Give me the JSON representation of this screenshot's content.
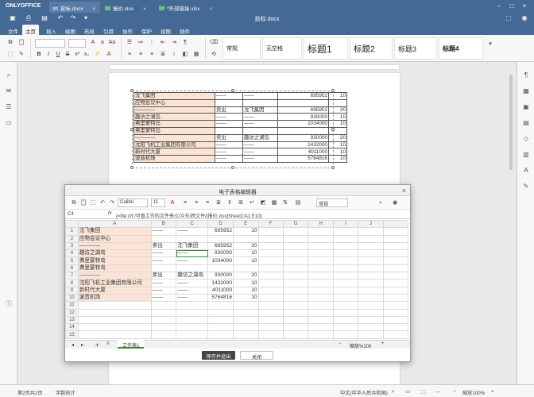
{
  "app": {
    "brand": "ONLYOFFICE",
    "doc_title": "投标.docx"
  },
  "window_tabs": [
    {
      "label": "投标.docx",
      "color": "#446995",
      "active": true
    },
    {
      "label": "报价.xlsx",
      "color": "#40865c",
      "active": false
    },
    {
      "label": "*外部链接.xlsx",
      "color": "#40865c",
      "active": false
    }
  ],
  "menu_tabs": [
    "文件",
    "主页",
    "插入",
    "绘图",
    "布局",
    "引用",
    "协作",
    "保护",
    "视图",
    "插件"
  ],
  "active_menu": "主页",
  "toolbar": {
    "style_gallery": [
      "常规",
      "无空格",
      "标题1",
      "标题2",
      "标题3",
      "标题4"
    ]
  },
  "page_table": {
    "rows": [
      [
        "沈飞集团",
        "——",
        "——",
        "695952",
        "10"
      ],
      [
        "应物会议中心",
        "",
        "",
        "",
        ""
      ],
      [
        "————",
        "卖出",
        "沈飞集团",
        "695952",
        "20"
      ],
      [
        "趣访之湖岛",
        "——",
        "——",
        "930000",
        "10"
      ],
      [
        "弗里蒙特岛",
        "——",
        "——",
        "1034000",
        "10"
      ],
      [
        "弗里蒙特岛",
        "",
        "",
        "",
        ""
      ],
      [
        "————",
        "卖出",
        "趣访之湖岛",
        "930000",
        "20"
      ],
      [
        "沈阳飞机工业集团有限公司",
        "——",
        "——",
        "1432000",
        "10"
      ],
      [
        "新时代大厦",
        "——",
        "——",
        "4011000",
        "10"
      ],
      [
        "波音机场",
        "——",
        "——",
        "5764816",
        "10"
      ]
    ]
  },
  "modal": {
    "title": "电子表格编辑器",
    "font_name": "Calibri",
    "font_size": "11",
    "number_format": "常规",
    "cell_ref": "C4",
    "fx": "fx",
    "formula": "{=file:///f:/可香工作的文件夹/公众号/跨文件/[报价.xlsx]Sheet1!A1:E10}",
    "columns": [
      "A",
      "B",
      "C",
      "D",
      "E",
      "F",
      "G",
      "H",
      "I",
      "J"
    ],
    "rows": [
      [
        "沈飞集团",
        "——",
        "——",
        "695952",
        "10"
      ],
      [
        "应物会议中心",
        "",
        "",
        "",
        ""
      ],
      [
        "————",
        "卖出",
        "沈飞集团",
        "695952",
        "20"
      ],
      [
        "趣访之湖岛",
        "——",
        "——",
        "930000",
        "10"
      ],
      [
        "弗里蒙特岛",
        "——",
        "——",
        "1034000",
        "10"
      ],
      [
        "弗里蒙特岛",
        "",
        "",
        "",
        ""
      ],
      [
        "————",
        "卖出",
        "趣访之湖岛",
        "930000",
        "20"
      ],
      [
        "沈阳飞机工业集团有限公司",
        "——",
        "——",
        "1432000",
        "10"
      ],
      [
        "新时代大厦",
        "——",
        "——",
        "4011000",
        "10"
      ],
      [
        "波音机场",
        "——",
        "——",
        "5764816",
        "10"
      ],
      [
        "",
        "",
        "",
        "",
        ""
      ],
      [
        "",
        "",
        "",
        "",
        ""
      ],
      [
        "",
        "",
        "",
        "",
        ""
      ],
      [
        "",
        "",
        "",
        "",
        ""
      ],
      [
        "",
        "",
        "",
        "",
        ""
      ]
    ],
    "sheet_tab": "工作表1",
    "zoom": "缩放%100",
    "save_button": "保存并退出",
    "close_button": "关闭"
  },
  "statusbar": {
    "page": "第2页共2页",
    "word_count": "字数统计",
    "language": "中文(中华人民共和国)",
    "zoom": "缩放100%"
  }
}
